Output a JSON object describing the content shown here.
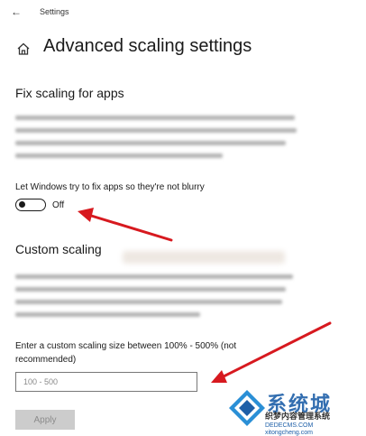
{
  "window": {
    "title": "Settings"
  },
  "page": {
    "title": "Advanced scaling settings"
  },
  "fix_scaling": {
    "heading": "Fix scaling for apps",
    "toggle_label": "Let Windows try to fix apps so they're not blurry",
    "toggle_state": "Off"
  },
  "custom_scaling": {
    "heading": "Custom scaling",
    "input_label": "Enter a custom scaling size between 100% - 500% (not recommended)",
    "input_placeholder": "100 - 500",
    "input_value": "",
    "apply_label": "Apply"
  },
  "watermark": {
    "title": "系统城",
    "subtitle": "织梦内容管理系统",
    "domain": "DEDECMS.COM",
    "url": "xitongcheng.com"
  },
  "colors": {
    "annotation_arrow": "#d7191f",
    "watermark_blue": "#1d5fa8",
    "apply_disabled_bg": "#cccccc"
  },
  "icons": {
    "back": "back-arrow-icon",
    "home": "home-icon"
  }
}
